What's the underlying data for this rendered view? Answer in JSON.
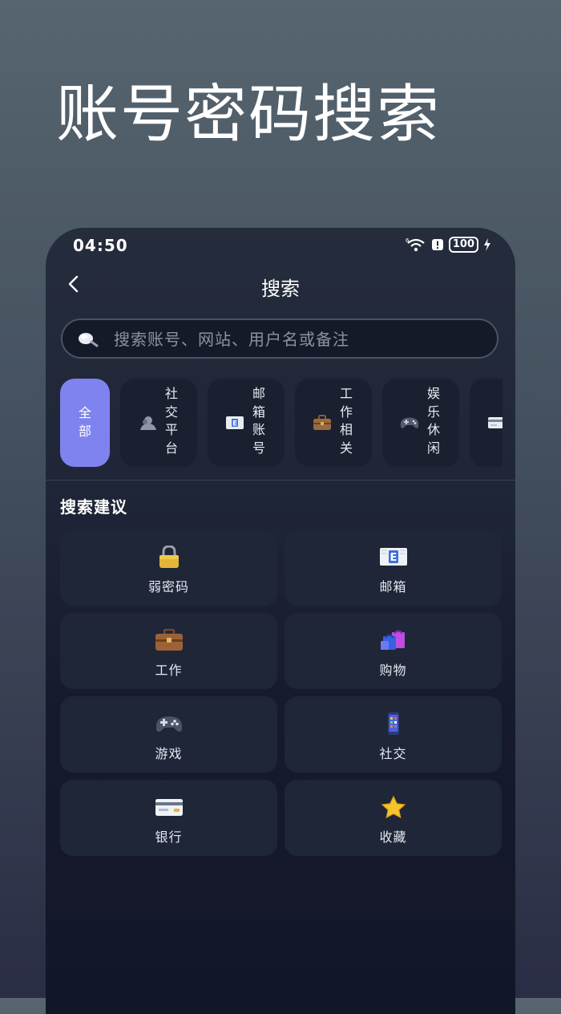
{
  "hero": {
    "title": "账号密码搜索"
  },
  "status_bar": {
    "time": "04:50",
    "battery": "100"
  },
  "nav": {
    "title": "搜索"
  },
  "search": {
    "placeholder": "搜索账号、网站、用户名或备注"
  },
  "categories": [
    {
      "label": "全部",
      "active": true
    },
    {
      "label": "社交平台",
      "icon": "person-icon"
    },
    {
      "label": "邮箱账号",
      "icon": "email-icon"
    },
    {
      "label": "工作相关",
      "icon": "briefcase-icon"
    },
    {
      "label": "娱乐休闲",
      "icon": "gamepad-icon"
    },
    {
      "label": "",
      "icon": "card-icon"
    }
  ],
  "suggestions": {
    "title": "搜索建议",
    "items": [
      {
        "label": "弱密码",
        "icon": "padlock-icon"
      },
      {
        "label": "邮箱",
        "icon": "email-icon"
      },
      {
        "label": "工作",
        "icon": "briefcase-icon"
      },
      {
        "label": "购物",
        "icon": "shopping-bags-icon"
      },
      {
        "label": "游戏",
        "icon": "gamepad-icon"
      },
      {
        "label": "社交",
        "icon": "phone-icon"
      },
      {
        "label": "银行",
        "icon": "card-icon"
      },
      {
        "label": "收藏",
        "icon": "star-icon"
      }
    ]
  },
  "colors": {
    "accent": "#7f83ef",
    "card": "#1e2638",
    "chip": "#1a2030"
  }
}
